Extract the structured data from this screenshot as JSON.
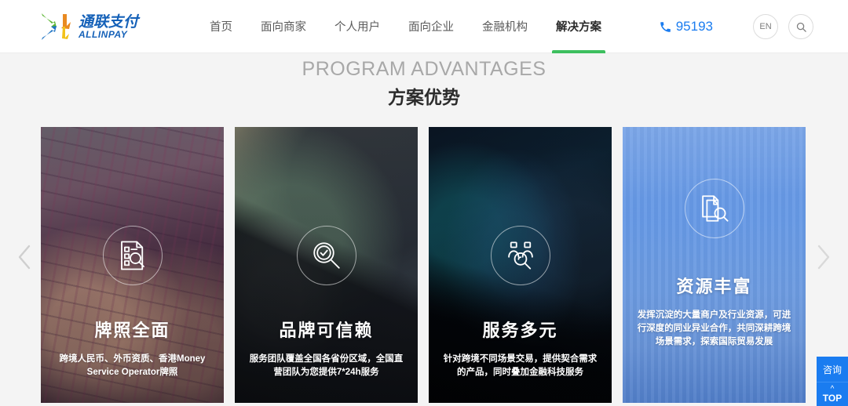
{
  "header": {
    "logo_alt": "通联支付 ALLINPAY",
    "nav": [
      {
        "label": "首页",
        "active": false
      },
      {
        "label": "面向商家",
        "active": false
      },
      {
        "label": "个人用户",
        "active": false
      },
      {
        "label": "面向企业",
        "active": false
      },
      {
        "label": "金融机构",
        "active": false
      },
      {
        "label": "解决方案",
        "active": true
      }
    ],
    "phone": "95193",
    "lang_button": "EN",
    "search_icon": "search-icon",
    "accent_green": "#3dbf5e",
    "accent_blue": "#1a7cf0"
  },
  "section": {
    "title_en": "PROGRAM ADVANTAGES",
    "title_cn": "方案优势"
  },
  "cards": [
    {
      "icon": "document-search-icon",
      "title": "牌照全面",
      "desc": "跨境人民币、外币资质、香港Money Service Operator牌照"
    },
    {
      "icon": "magnifier-check-icon",
      "title": "品牌可信赖",
      "desc": "服务团队覆盖全国各省份区域，全国直营团队为您提供7*24h服务"
    },
    {
      "icon": "people-search-icon",
      "title": "服务多元",
      "desc": "针对跨境不同场景交易，提供契合需求的产品，同时叠加金融科技服务"
    },
    {
      "icon": "files-search-icon",
      "title": "资源丰富",
      "desc": "发挥沉淀的大量商户及行业资源，可进行深度的同业异业合作，共同深耕跨境场景需求，探索国际贸易发展"
    }
  ],
  "carousel": {
    "prev_icon": "chevron-left-icon",
    "next_icon": "chevron-right-icon"
  },
  "side_widget": {
    "consult_label": "咨询",
    "top_label": "TOP",
    "top_icon": "chevron-up-icon",
    "color": "#1a7cf0"
  }
}
